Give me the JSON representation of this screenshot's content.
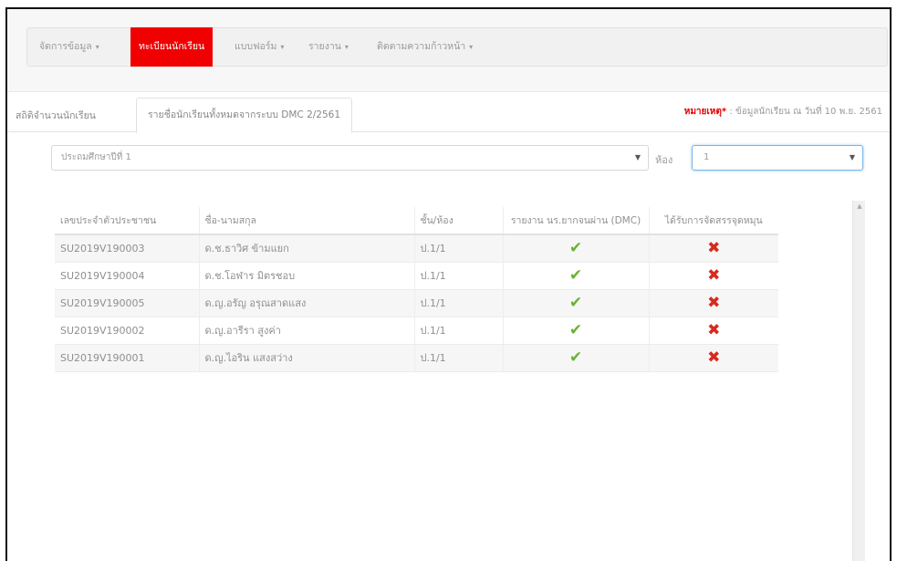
{
  "navbar": {
    "items": [
      {
        "label": "จัดการข้อมูล",
        "caret": "▾"
      },
      {
        "label": "ทะเบียนนักเรียน",
        "caret": ""
      },
      {
        "label": "แบบฟอร์ม",
        "caret": "▾"
      },
      {
        "label": "รายงาน",
        "caret": "▾"
      },
      {
        "label": "ติดตามความก้าวหน้า",
        "caret": "▾"
      }
    ],
    "active_color": "#f00000"
  },
  "tabs": [
    {
      "label": "สถิติจำนวนนักเรียน"
    },
    {
      "label": "รายชื่อนักเรียนทั้งหมดจากระบบ DMC 2/2561"
    }
  ],
  "note": {
    "label": "หมายเหตุ*",
    "text": " : ข้อมูลนักเรียน ณ วันที่ 10 พ.ย. 2561"
  },
  "filters": {
    "level_value": "ประถมศึกษาปีที่ 1",
    "room_label": "ห้อง",
    "room_value": "1"
  },
  "table": {
    "headers": [
      "เลขประจำตัวประชาชน",
      "ชื่อ-นามสกุล",
      "ชั้น/ห้อง",
      "รายงาน นร.ยากจนผ่าน (DMC)",
      "ได้รับการจัดสรรจุดหมุน"
    ],
    "rows": [
      {
        "id": "SU2019V190003",
        "name": "ด.ช.ธาวิศ ข้ามแยก",
        "class": "ป.1/1",
        "dmc": "✔",
        "awarded": "✖"
      },
      {
        "id": "SU2019V190004",
        "name": "ด.ช.โอฬาร มิตรชอบ",
        "class": "ป.1/1",
        "dmc": "✔",
        "awarded": "✖"
      },
      {
        "id": "SU2019V190005",
        "name": "ด.ญ.อรัญ อรุณสาดแสง",
        "class": "ป.1/1",
        "dmc": "✔",
        "awarded": "✖"
      },
      {
        "id": "SU2019V190002",
        "name": "ด.ญ.อารีรา สูงค่า",
        "class": "ป.1/1",
        "dmc": "✔",
        "awarded": "✖"
      },
      {
        "id": "SU2019V190001",
        "name": "ด.ญ.ไอริน แสงสว่าง",
        "class": "ป.1/1",
        "dmc": "✔",
        "awarded": "✖"
      }
    ]
  },
  "icons": {
    "check": "check-icon",
    "cross": "cross-icon",
    "scroll_up": "scroll-up-icon"
  },
  "colors": {
    "check": "#6ab232",
    "cross": "#d62b1f",
    "note_label": "#e00000"
  }
}
